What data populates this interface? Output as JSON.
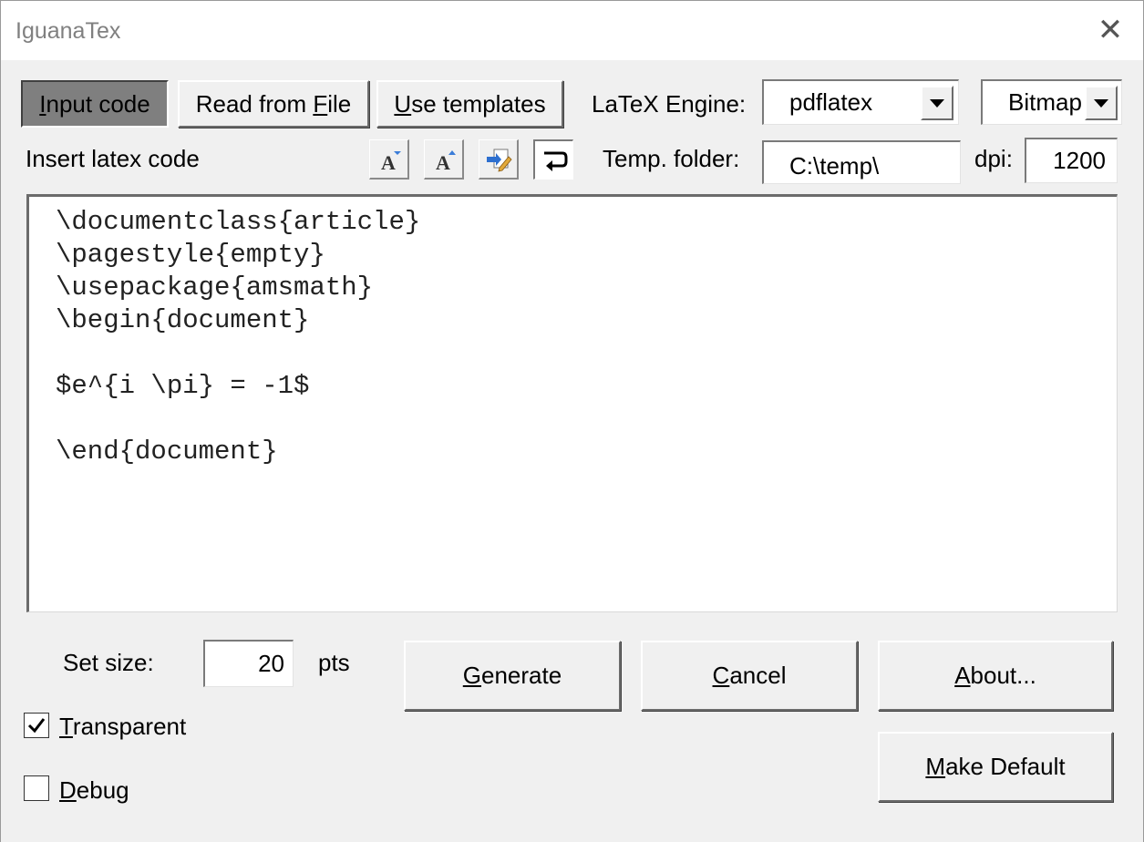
{
  "window": {
    "title": "IguanaTex",
    "close_glyph": "✕"
  },
  "toolbar": {
    "input_code": {
      "pre": "",
      "ul": "I",
      "post": "nput code"
    },
    "read_from_file": {
      "pre": "Read from ",
      "ul": "F",
      "post": "ile"
    },
    "use_templates": {
      "pre": "",
      "ul": "U",
      "post": "se templates"
    }
  },
  "engine": {
    "label": "LaTeX Engine:",
    "value": "pdflatex"
  },
  "output_format": {
    "value": "Bitmap"
  },
  "insert_label": "Insert latex code",
  "icon_buttons": [
    "decrease-font-icon",
    "increase-font-icon",
    "edit-external-icon",
    "word-wrap-icon"
  ],
  "temp_folder": {
    "label": "Temp. folder:",
    "value": "C:\\temp\\"
  },
  "dpi": {
    "label": "dpi:",
    "value": "1200"
  },
  "editor": {
    "code": "\\documentclass{article}\n\\pagestyle{empty}\n\\usepackage{amsmath}\n\\begin{document}\n\n$e^{i \\pi} = -1$\n\n\\end{document}"
  },
  "size": {
    "label": "Set size:",
    "value": "20",
    "unit": "pts"
  },
  "options": {
    "transparent": {
      "pre": "",
      "ul": "T",
      "post": "ransparent",
      "checked": true
    },
    "debug": {
      "pre": "",
      "ul": "D",
      "post": "ebug",
      "checked": false
    }
  },
  "actions": {
    "generate": {
      "pre": "",
      "ul": "G",
      "post": "enerate"
    },
    "cancel": {
      "pre": "",
      "ul": "C",
      "post": "ancel"
    },
    "about": {
      "pre": "",
      "ul": "A",
      "post": "bout..."
    },
    "make_default": {
      "pre": "",
      "ul": "M",
      "post": "ake Default"
    }
  },
  "colors": {
    "pressed_button": "#7f7f7f",
    "background": "#f0f0f0",
    "title_text": "#808080"
  }
}
